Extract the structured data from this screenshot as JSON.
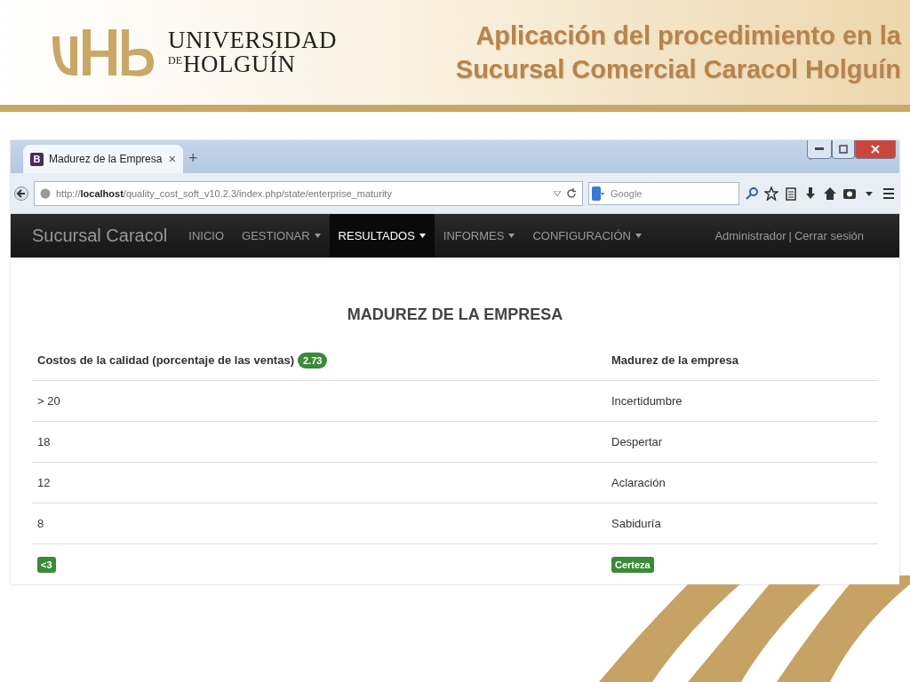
{
  "slide": {
    "university": {
      "line_1": "UNIVERSIDAD",
      "line_2_prefix": "DE",
      "line_2": "HOLGUÍN"
    },
    "title_lines": [
      "Aplicación del procedimiento en la",
      "Sucursal Comercial Caracol Holguín"
    ]
  },
  "browser": {
    "tab": {
      "favicon": "B",
      "title": "Madurez de la Empresa",
      "close": "×"
    },
    "new_tab": "+",
    "url": {
      "prefix": "http://",
      "host": "localhost",
      "path": "/quality_cost_soft_v10.2.3/index.php/state/enterprise_maturity"
    },
    "search": {
      "placeholder": "Google"
    }
  },
  "navbar": {
    "brand": "Sucursal Caracol",
    "items": [
      {
        "label": "INICIO",
        "dropdown": false,
        "selected": false
      },
      {
        "label": "GESTIONAR",
        "dropdown": true,
        "selected": false
      },
      {
        "label": "RESULTADOS",
        "dropdown": true,
        "selected": true
      },
      {
        "label": "INFORMES",
        "dropdown": true,
        "selected": false
      },
      {
        "label": "CONFIGURACIÓN",
        "dropdown": true,
        "selected": false
      }
    ],
    "user": "Administrador",
    "separator": "|",
    "logout": "Cerrar sesión"
  },
  "page": {
    "heading": "MADUREZ DE LA EMPRESA",
    "table": {
      "columns": [
        {
          "label": "Costos de la calidad (porcentaje de las ventas)",
          "badge": "2.73"
        },
        {
          "label": "Madurez de la empresa"
        }
      ],
      "rows": [
        {
          "cells": [
            "> 20",
            "Incertidumbre"
          ],
          "highlighted": false
        },
        {
          "cells": [
            "18",
            "Despertar"
          ],
          "highlighted": false
        },
        {
          "cells": [
            "12",
            "Aclaración"
          ],
          "highlighted": false
        },
        {
          "cells": [
            "8",
            "Sabiduría"
          ],
          "highlighted": false
        },
        {
          "cells": [
            "<3",
            "Certeza"
          ],
          "highlighted": true
        }
      ]
    }
  }
}
